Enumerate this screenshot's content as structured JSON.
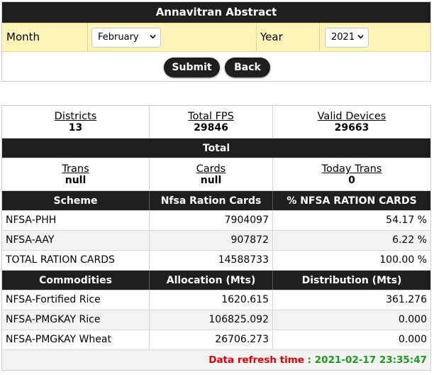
{
  "panel": {
    "title": "Annavitran Abstract",
    "month_label": "Month",
    "month_value": "February",
    "year_label": "Year",
    "year_value": "2021",
    "submit_label": "Submit",
    "back_label": "Back"
  },
  "summary": {
    "districts_label": "Districts",
    "districts_value": "13",
    "fps_label": "Total FPS",
    "fps_value": "29846",
    "devices_label": "Valid Devices",
    "devices_value": "29663"
  },
  "total": {
    "title": "Total",
    "trans_label": "Trans",
    "trans_value": "null",
    "cards_label": "Cards",
    "cards_value": "null",
    "today_label": "Today Trans",
    "today_value": "0"
  },
  "scheme_table": {
    "headers": [
      "Scheme",
      "Nfsa Ration Cards",
      "% NFSA RATION CARDS"
    ],
    "rows": [
      [
        "NFSA-PHH",
        "7904097",
        "54.17 %"
      ],
      [
        "NFSA-AAY",
        "907872",
        "6.22 %"
      ],
      [
        "TOTAL RATION CARDS",
        "14588733",
        "100.00 %"
      ]
    ]
  },
  "commodity_table": {
    "headers": [
      "Commodities",
      "Allocation (Mts)",
      "Distribution (Mts)"
    ],
    "rows": [
      [
        "NFSA-Fortified Rice",
        "1620.615",
        "361.276"
      ],
      [
        "NFSA-PMGKAY Rice",
        "106825.092",
        "0.000"
      ],
      [
        "NFSA-PMGKAY Wheat",
        "26706.273",
        "0.000"
      ]
    ]
  },
  "refresh": {
    "label": "Data refresh time",
    "separator": ":",
    "time": "2021-02-17 23:35:47"
  },
  "colors": {
    "header_dark": "#1f1f1f",
    "filter_bg": "#fff4b8",
    "refresh_label": "#e00000",
    "refresh_time": "#1a9c1a"
  }
}
